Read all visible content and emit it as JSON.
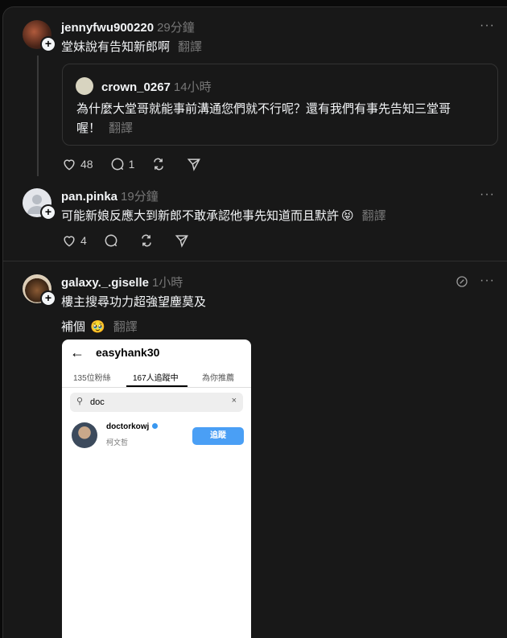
{
  "post1": {
    "username": "jennyfwu900220",
    "time": "29分鐘",
    "text": "堂妹說有告知新郎啊",
    "translate": "翻譯",
    "more": "···",
    "likes": "48",
    "comments": "1",
    "quote": {
      "username": "crown_0267",
      "time": "14小時",
      "text_line1": "為什麼大堂哥就能事前溝通您們就不行呢？還有我們有事先告知三堂哥",
      "text_line2": "喔！",
      "translate": "翻譯"
    }
  },
  "post2": {
    "username": "pan.pinka",
    "time": "19分鐘",
    "text": "可能新娘反應大到新郎不敢承認他事先知道而且默許",
    "emoji": "😝",
    "translate": "翻譯",
    "more": "···",
    "likes": "4"
  },
  "post3": {
    "username": "galaxy._.giselle",
    "time": "1小時",
    "text": "樓主搜尋功力超強望塵莫及",
    "line2": "補個",
    "emoji": "🥹",
    "translate": "翻譯",
    "more": "···"
  },
  "screenshot": {
    "title": "easyhank30",
    "tabs": [
      "135位粉絲",
      "167人追蹤中",
      "為你推薦"
    ],
    "search_value": "doc",
    "result_username": "doctorkowj",
    "result_name": "柯文哲",
    "follow_label": "追蹤"
  }
}
